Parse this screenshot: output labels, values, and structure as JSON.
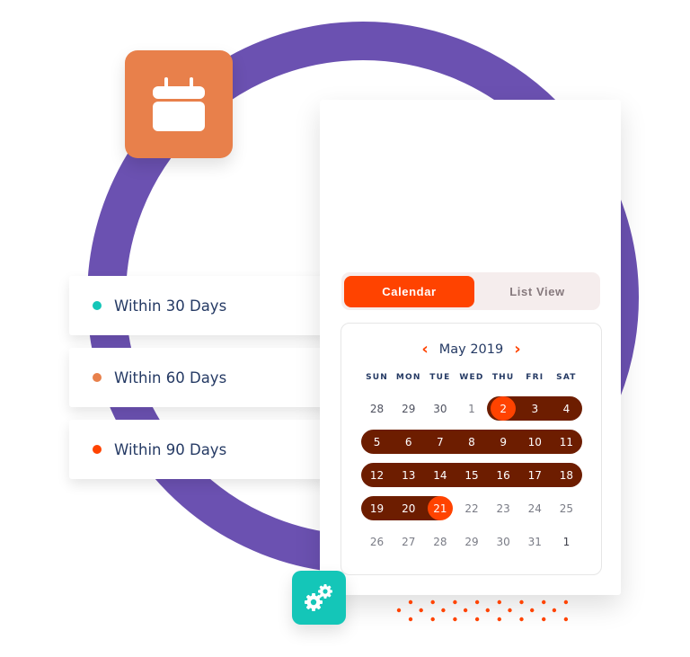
{
  "colors": {
    "ring": "#6b51b1",
    "calendar_tile": "#e8804b",
    "gear_tile": "#14c6b8",
    "accent": "#ff4300",
    "range": "#6d1d00",
    "text_dark": "#253a64"
  },
  "icons": {
    "top_tile": "calendar-icon",
    "bottom_tile": "gears-icon"
  },
  "legend": [
    {
      "label": "Within 30 Days",
      "color": "#14c6b8"
    },
    {
      "label": "Within 60 Days",
      "color": "#e8804b"
    },
    {
      "label": "Within 90 Days",
      "color": "#ff4300"
    }
  ],
  "tabs": {
    "active": "Calendar",
    "inactive": "List View"
  },
  "calendar": {
    "month": "May 2019",
    "prev_icon": "chevron-left-icon",
    "next_icon": "chevron-right-icon",
    "weekdays": [
      "SUN",
      "MON",
      "TUE",
      "WED",
      "THU",
      "FRI",
      "SAT"
    ],
    "weeks": [
      [
        "28",
        "29",
        "30",
        "1",
        "2",
        "3",
        "4"
      ],
      [
        "5",
        "6",
        "7",
        "8",
        "9",
        "10",
        "11"
      ],
      [
        "12",
        "13",
        "14",
        "15",
        "16",
        "17",
        "18"
      ],
      [
        "19",
        "20",
        "21",
        "22",
        "23",
        "24",
        "25"
      ],
      [
        "26",
        "27",
        "28",
        "29",
        "30",
        "31",
        "1"
      ]
    ],
    "range_start": "2",
    "range_end": "21"
  }
}
